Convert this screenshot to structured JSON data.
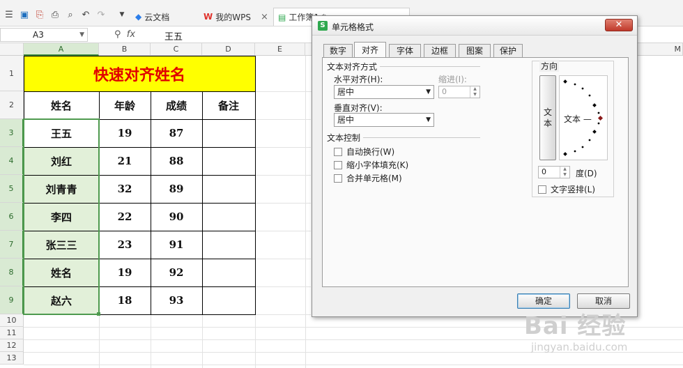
{
  "toolbar": {
    "icons": [
      "app-menu-icon",
      "save-icon",
      "export-pdf-icon",
      "print-icon",
      "print-preview-icon",
      "undo-icon",
      "redo-icon",
      "more-dropdown-icon"
    ],
    "tabs": [
      {
        "label": "云文档",
        "icon": "cloud-doc-icon",
        "closable": false
      },
      {
        "label": "我的WPS",
        "icon": "wps-logo-icon",
        "closable": true
      },
      {
        "label": "工作簿1 *",
        "icon": "workbook-icon",
        "closable": false
      }
    ]
  },
  "formula_bar": {
    "name_box": "A3",
    "fx_label": "fx",
    "value": "王五"
  },
  "sheet": {
    "columns": [
      "A",
      "B",
      "C",
      "D",
      "E",
      "M"
    ],
    "rows": [
      "1",
      "2",
      "3",
      "4",
      "5",
      "6",
      "7",
      "8",
      "9",
      "10",
      "11",
      "12",
      "13"
    ],
    "title": "快速对齐姓名",
    "headers": [
      "姓名",
      "年龄",
      "成绩",
      "备注"
    ],
    "data": [
      [
        "王五",
        "19",
        "87",
        ""
      ],
      [
        "刘红",
        "21",
        "88",
        ""
      ],
      [
        "刘青青",
        "32",
        "89",
        ""
      ],
      [
        "李四",
        "22",
        "90",
        ""
      ],
      [
        "张三三",
        "23",
        "91",
        ""
      ],
      [
        "姓名",
        "19",
        "92",
        ""
      ],
      [
        "赵六",
        "18",
        "93",
        ""
      ]
    ],
    "colors": {
      "title_bg": "#ffff00",
      "title_text": "#e00000",
      "selection_bg": "#e2f0d9",
      "selection_border": "#4e9a4e"
    }
  },
  "dialog": {
    "title": "单元格格式",
    "close_label": "✕",
    "tabs": [
      "数字",
      "对齐",
      "字体",
      "边框",
      "图案",
      "保护"
    ],
    "active_tab": "对齐",
    "alignment_section": "文本对齐方式",
    "horizontal_label": "水平对齐(H):",
    "horizontal_value": "居中",
    "indent_label": "缩进(I):",
    "indent_value": "0",
    "vertical_label": "垂直对齐(V):",
    "vertical_value": "居中",
    "control_section": "文本控制",
    "checkboxes": [
      "自动换行(W)",
      "缩小字体填充(K)",
      "合并单元格(M)"
    ],
    "orientation_section": "方向",
    "vertical_text_button": [
      "文",
      "本"
    ],
    "dial_text": "文本 —",
    "degree_value": "0",
    "degree_label": "度(D)",
    "vertical_layout_label": "文字竖排(L)",
    "ok_label": "确定",
    "cancel_label": "取消"
  },
  "watermark": {
    "line1": "Bai 经验",
    "line2": "jingyan.baidu.com"
  }
}
